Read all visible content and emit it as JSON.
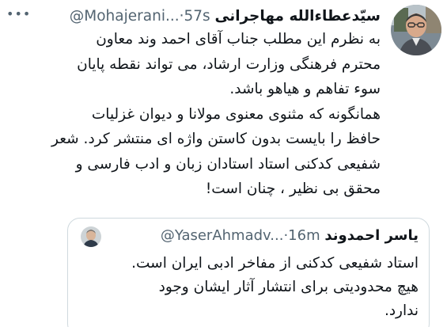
{
  "tweet": {
    "author_name": "سیّدعطاءالله مهاجرانی",
    "handle_time": "@Mohajerani...·57s",
    "more_symbol": "•••",
    "lines": [
      "به نظرم این مطلب جناب آقای احمد وند معاون",
      "محترم فرهنگی وزارت ارشاد، می تواند نقطه پایان",
      "سوء تفاهم و هیاهو باشد.",
      "همانگونه که مثنوی معنوی مولانا و دیوان غزلیات",
      "حافظ را بایست بدون کاستن واژه ای منتشر کرد. شعر",
      "شفیعی کدکنی استاد استادان زبان و ادب فارسی و",
      "محقق بی نظیر ، چنان است!"
    ]
  },
  "quoted_tweet": {
    "author_name": "یاسر احمدوند",
    "handle_time": "@YaserAhmadv...·16m",
    "lines": [
      "استاد شفیعی کدکنی از مفاخر ادبی ایران است.",
      "هیچ محدودیتی برای انتشار آثار ایشان وجود",
      "ندارد."
    ]
  }
}
